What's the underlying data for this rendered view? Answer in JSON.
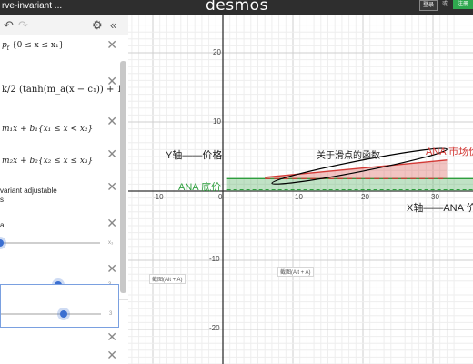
{
  "topbar": {
    "doc_title": "rve-invariant ...",
    "brand": "desmos",
    "login": "登录",
    "lang": "或",
    "register": "注册"
  },
  "toolbar": {
    "undo": "↶",
    "redo": "↷",
    "settings": "⚙",
    "collapse": "«"
  },
  "expressions": [
    {
      "text": "p",
      "sub": "f",
      "rest": "{0 ≤ x ≤ x₁}"
    },
    {
      "text": "k/2 (tanh(m_a(x − c₁)) + 1"
    },
    {
      "text": "m₁x + b₁{x₁ ≤ x < x₂}"
    },
    {
      "text": "m₂x + b₂{x₂ ≤ x ≤ x₃}"
    }
  ],
  "note": {
    "line1": "variant adjustable",
    "line2": "s"
  },
  "sliders": [
    {
      "label": "a",
      "max": "x₃",
      "value": 0.0
    },
    {
      "max": "3",
      "value": 0.58
    },
    {
      "max": "3",
      "value": 0.62
    }
  ],
  "graph": {
    "xticks": [
      "-10",
      "0",
      "10",
      "20",
      "30"
    ],
    "yticks": [
      "20",
      "10",
      "-10",
      "-20"
    ],
    "annotations": {
      "y_axis": "Y轴——价格",
      "x_axis": "X轴——ANA 价",
      "slider_func": "关于滑点的函数",
      "market": "ANA 市场价",
      "floor": "ANA 底价",
      "snip1": "截图(Alt + A)",
      "snip2": "截图(Alt + A)"
    },
    "colors": {
      "red": "#d33a36",
      "green": "#2e9f3e",
      "black": "#000000"
    },
    "chart_data": {
      "type": "area",
      "xlim": [
        -13,
        33
      ],
      "ylim": [
        -25,
        24
      ],
      "grid": true,
      "floor_price": 1.8,
      "market_line": {
        "x": [
          6,
          32
        ],
        "y": [
          2,
          4.5
        ]
      }
    }
  }
}
